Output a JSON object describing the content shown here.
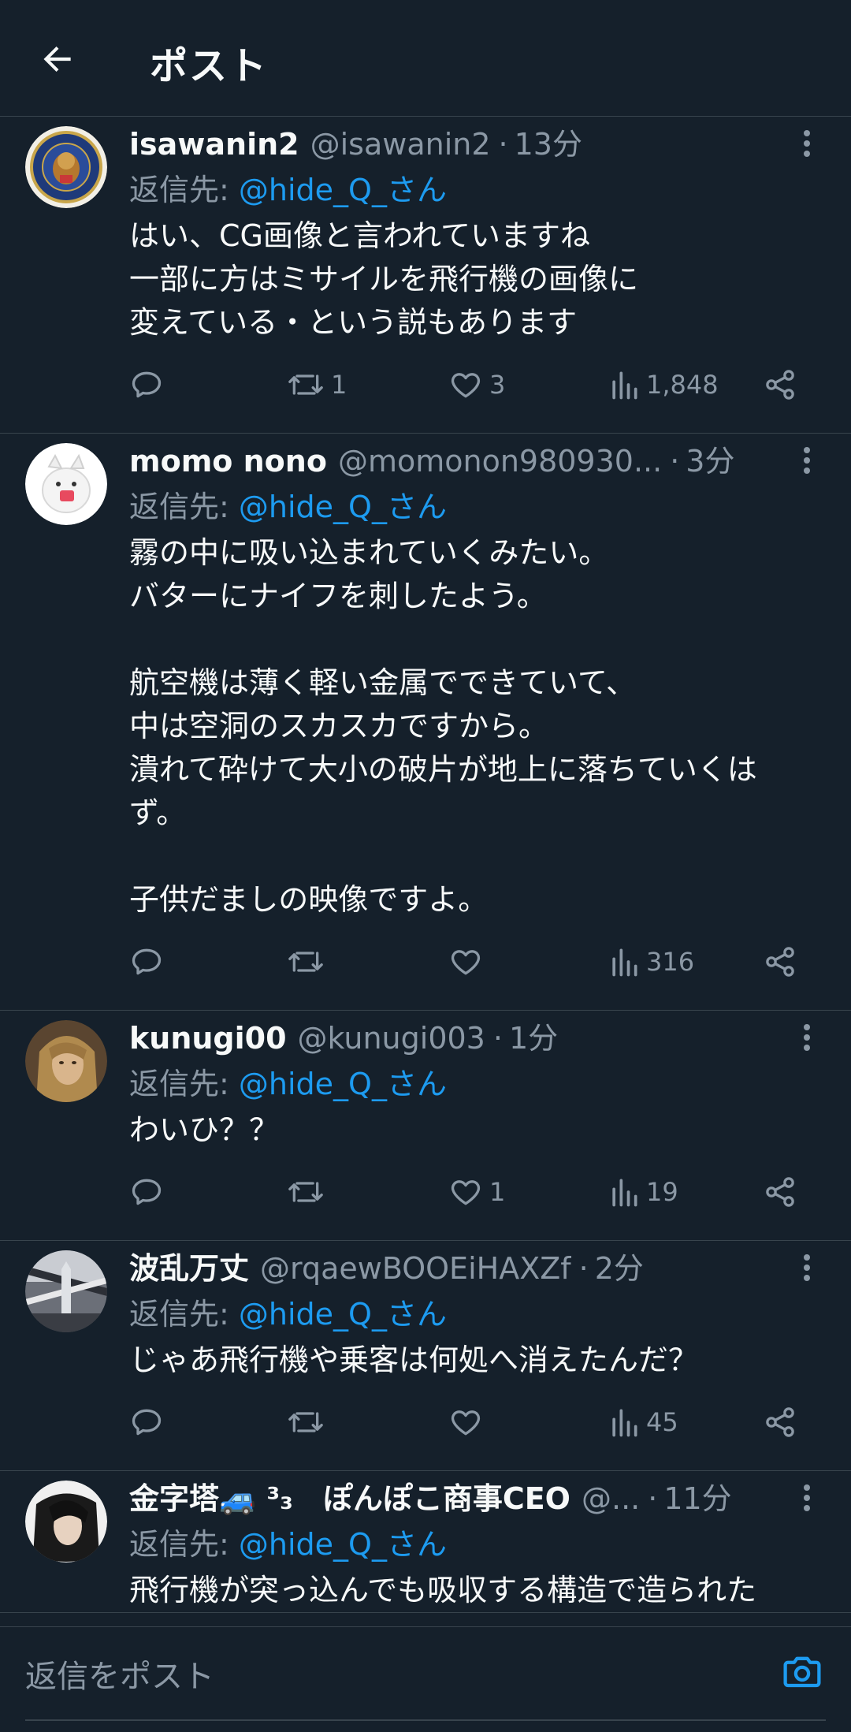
{
  "header": {
    "title": "ポスト"
  },
  "reply_label": "返信先:",
  "tweets": [
    {
      "name": "isawanin2",
      "handle": "@isawanin2",
      "time": "13分",
      "reply_to": "@hide_Q_さん",
      "text": "はい、CG画像と言われていますね\n一部に方はミサイルを飛行機の画像に\n変えている・という説もあります",
      "retweets": "1",
      "likes": "3",
      "views": "1,848"
    },
    {
      "name": "momo nono",
      "handle": "@momonon980930...",
      "time": "3分",
      "reply_to": "@hide_Q_さん",
      "text": "霧の中に吸い込まれていくみたい。\nバターにナイフを刺したよう。\n\n航空機は薄く軽い金属でできていて、\n中は空洞のスカスカですから。\n潰れて砕けて大小の破片が地上に落ちていくは\nず。\n\n子供だましの映像ですよ。",
      "retweets": "",
      "likes": "",
      "views": "316"
    },
    {
      "name": "kunugi00",
      "handle": "@kunugi003",
      "time": "1分",
      "reply_to": "@hide_Q_さん",
      "text": "わいひ？？",
      "retweets": "",
      "likes": "1",
      "views": "19"
    },
    {
      "name": "波乱万丈",
      "handle": "@rqaewBOOEiHAXZf",
      "time": "2分",
      "reply_to": "@hide_Q_さん",
      "text": "じゃあ飛行機や乗客は何処へ消えたんだ？",
      "retweets": "",
      "likes": "",
      "views": "45"
    },
    {
      "name": "金字塔🚙 ³₃　ぽんぽこ商事CEO",
      "handle": "@...",
      "time": "11分",
      "reply_to": "@hide_Q_さん",
      "text": "飛行機が突っ込んでも吸収する構造で造られた",
      "retweets": "",
      "likes": "",
      "views": ""
    }
  ],
  "composer": {
    "placeholder": "返信をポスト"
  },
  "icons": {
    "back": "arrow-left-icon",
    "more": "more-vertical-icon",
    "reply": "reply-icon",
    "retweet": "retweet-icon",
    "like": "heart-icon",
    "views": "views-icon",
    "share": "share-icon",
    "camera": "camera-icon"
  },
  "colors": {
    "background": "#15202b",
    "divider": "#38444d",
    "text_primary": "#f7f9f9",
    "text_secondary": "#8b98a5",
    "accent": "#1d9bf0"
  }
}
